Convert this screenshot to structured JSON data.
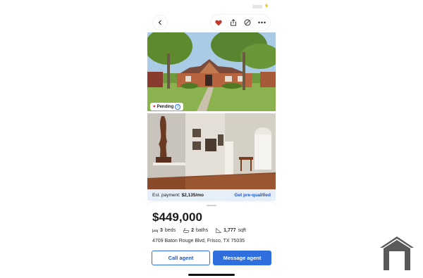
{
  "status_bar": {
    "battery_icon": "charging-bolt-icon"
  },
  "toolbar": {
    "back_icon": "chevron-left-icon",
    "favorite_icon": "heart-icon",
    "share_icon": "share-icon",
    "hide_icon": "block-icon",
    "more_icon": "more-dots-icon",
    "favorite_color": "#c0392b"
  },
  "listing": {
    "status_badge": "Pending",
    "payment_label": "Est. payment:",
    "payment_value": "$2,135/mo",
    "prequal_link": "Get pre-qualified",
    "price": "$449,000",
    "beds_value": "3",
    "beds_label": "beds",
    "baths_value": "2",
    "baths_label": "baths",
    "sqft_value": "1,777",
    "sqft_label": "sqft",
    "address": "4709 Baton Rouge Blvd, Frisco, TX 75035"
  },
  "actions": {
    "call_label": "Call agent",
    "message_label": "Message agent",
    "accent_color": "#2f6fdd"
  },
  "watermark": {
    "icon": "house-logo-icon"
  }
}
